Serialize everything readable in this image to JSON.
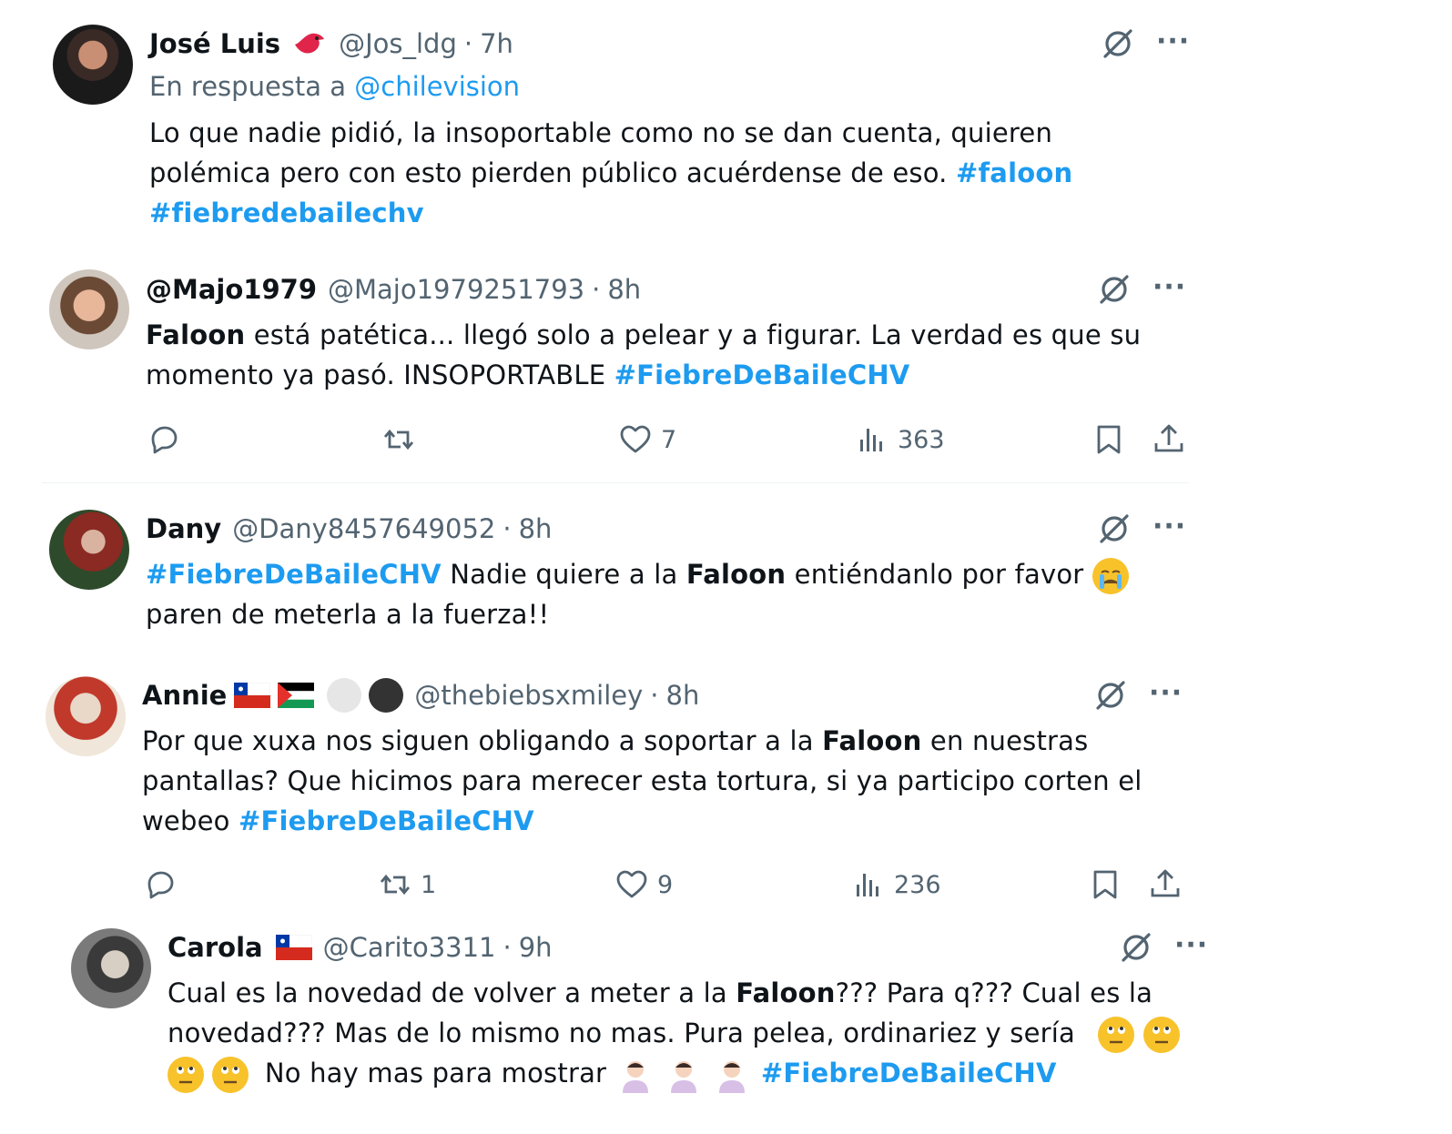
{
  "tweets": [
    {
      "name": "José Luis",
      "handle": "@Jos_ldg",
      "time": "7h",
      "reply_prefix": "En respuesta a",
      "reply_mention": "@chilevision",
      "text_line1": "Lo que nadie pidió, la insoportable como no se dan cuenta, quieren",
      "text_line2": "polémica pero con esto pierden público acuérdense de eso.",
      "tag1": "#faloon",
      "tag2": "#fiebredebailechv"
    },
    {
      "name": "@Majo1979",
      "handle": "@Majo1979251793",
      "time": "8h",
      "bold_word": "Faloon",
      "text_line1_rest": "está patética... llegó solo a pelear y a figurar. La verdad es que su",
      "text_line2": "momento ya pasó. INSOPORTABLE",
      "tag": "#FiebreDeBaileCHV",
      "likes": "7",
      "views": "363"
    },
    {
      "name": "Dany",
      "handle": "@Dany8457649052",
      "time": "8h",
      "tag": "#FiebreDeBaileCHV",
      "text_a": "Nadie quiere a la",
      "bold_word": "Faloon",
      "text_b": "entiéndanlo por favor",
      "text_line2": "paren de meterla a la fuerza!!"
    },
    {
      "name": "Annie",
      "handle": "@thebiebsxmiley",
      "time": "8h",
      "text_a": "Por que xuxa nos siguen obligando a soportar a la",
      "bold_word": "Faloon",
      "text_b": "en nuestras",
      "text_line2": "pantallas? Que hicimos para merecer esta tortura, si ya participo corten el",
      "text_line3": "webeo",
      "tag": "#FiebreDeBaileCHV",
      "retweets": "1",
      "likes": "9",
      "views": "236"
    },
    {
      "name": "Carola",
      "handle": "@Carito3311",
      "time": "9h",
      "text_a": "Cual es la novedad de volver a meter a la",
      "bold_word": "Faloon",
      "text_b": "??? Para q??? Cual es la",
      "text_line2": "novedad??? Mas de lo mismo no mas. Pura pelea, ordinariez y sería",
      "text_line3": "No hay mas para mostrar",
      "tag": "#FiebreDeBaileCHV"
    }
  ],
  "dot": "·",
  "more_label": "···",
  "icons": {
    "grok": "grok-icon",
    "reply": "reply-icon",
    "retweet": "retweet-icon",
    "like": "heart-icon",
    "views": "views-icon",
    "bookmark": "bookmark-icon",
    "share": "share-icon"
  },
  "colors": {
    "accent": "#1d9bf0",
    "secondary": "#536471",
    "text": "#0f1419"
  }
}
